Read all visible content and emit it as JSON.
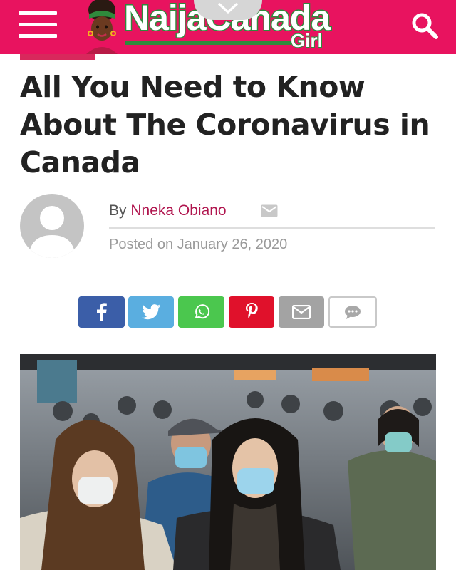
{
  "header": {
    "brand_main": "NaijaCanada",
    "brand_sub": "Girl",
    "bg_color": "#e8135f",
    "brand_color": "#2f8a3c",
    "icons": [
      "menu-icon",
      "chevron-down-icon",
      "search-icon"
    ]
  },
  "article": {
    "title": "All You Need to Know About The Coronavirus in Canada",
    "byline_prefix": "By",
    "author": "Nneka Obiano",
    "posted": "Posted on January 26, 2020"
  },
  "share": {
    "buttons": [
      {
        "network": "facebook",
        "icon": "facebook-icon",
        "color": "#3b5ea8"
      },
      {
        "network": "twitter",
        "icon": "twitter-icon",
        "color": "#5aaee0"
      },
      {
        "network": "whatsapp",
        "icon": "whatsapp-icon",
        "color": "#4bc74e"
      },
      {
        "network": "pinterest",
        "icon": "pinterest-icon",
        "color": "#e0112b"
      },
      {
        "network": "email",
        "icon": "mail-icon",
        "color": "#a3a3a3"
      },
      {
        "network": "comments",
        "icon": "comment-icon",
        "color": "#ffffff"
      }
    ]
  }
}
